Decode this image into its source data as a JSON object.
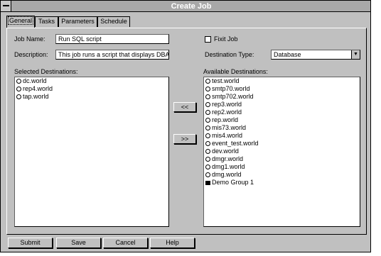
{
  "window": {
    "title": "Create Job"
  },
  "tabs": [
    {
      "label": "General",
      "active": true
    },
    {
      "label": "Tasks",
      "active": false
    },
    {
      "label": "Parameters",
      "active": false
    },
    {
      "label": "Schedule",
      "active": false
    }
  ],
  "general": {
    "job_name_label": "Job Name:",
    "job_name_value": "Run SQL script",
    "description_label": "Description:",
    "description_value": "This job runs a script that displays DBA",
    "fixit_label": "Fixit Job",
    "fixit_checked": false,
    "destination_type_label": "Destination Type:",
    "destination_type_value": "Database",
    "selected_label": "Selected Destinations:",
    "available_label": "Available Destinations:",
    "selected": [
      "dc.world",
      "rep4.world",
      "tap.world"
    ],
    "available": [
      "test.world",
      "smtp70.world",
      "smtp702.world",
      "rep3.world",
      "rep2.world",
      "rep.world",
      "mis73.world",
      "mis4.world",
      "event_test.world",
      "dev.world",
      "dmgr.world",
      "dmg1.world",
      "dmg.world"
    ],
    "available_group": "Demo Group 1",
    "add_button": "<<",
    "remove_button": ">>"
  },
  "buttons": {
    "submit": "Submit",
    "save": "Save",
    "cancel": "Cancel",
    "help": "Help"
  },
  "icons": {
    "destination": "database-node-icon",
    "group": "group-icon",
    "dropdown": "chevron-down-icon",
    "system_menu": "system-menu-icon"
  },
  "colors": {
    "titlebar": "#a8a8a8",
    "face": "#c0c0c0",
    "field": "#ffffff"
  }
}
